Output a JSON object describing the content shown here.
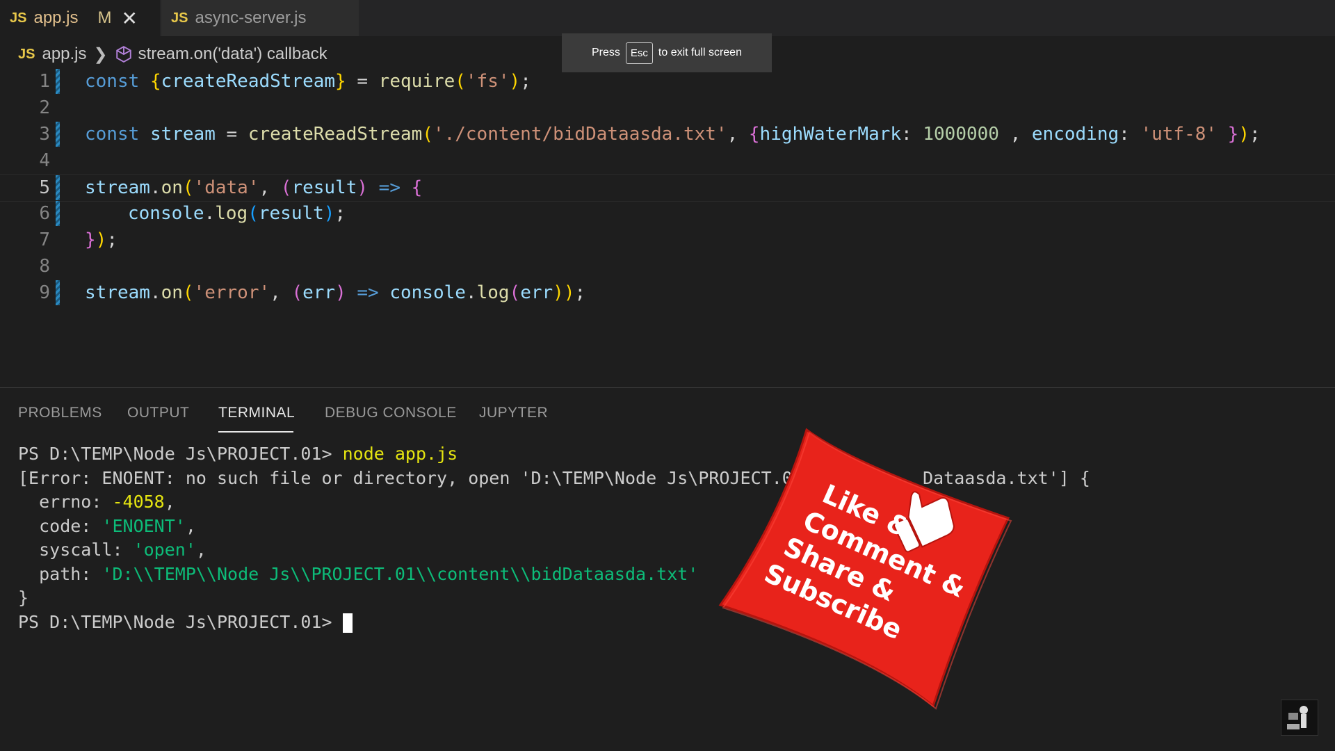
{
  "tabs": [
    {
      "badge": "JS",
      "label": "app.js",
      "modified": "M",
      "close": "✕"
    },
    {
      "badge": "JS",
      "label": "async-server.js"
    }
  ],
  "breadcrumb": {
    "badge": "JS",
    "file": "app.js",
    "sep": "❯",
    "symbol": "stream.on('data') callback"
  },
  "fullscreen_toast": {
    "before": "Press",
    "key": "Esc",
    "after": "to exit full screen"
  },
  "line_numbers": [
    "1",
    "2",
    "3",
    "4",
    "5",
    "6",
    "7",
    "8",
    "9"
  ],
  "code": {
    "l1": {
      "kw": "const",
      "open": "{",
      "ident": "createReadStream",
      "close": "}",
      "eq": " = ",
      "fn": "require",
      "p1": "(",
      "str": "'fs'",
      "p2": ")",
      "semi": ";"
    },
    "l3": {
      "kw": "const",
      "var": "stream",
      "eq": " = ",
      "fn": "createReadStream",
      "p1": "(",
      "str": "'./content/bidDataasda.txt'",
      "comma": ", ",
      "ob": "{",
      "k1": "highWaterMark",
      "c1": ": ",
      "n1": "1000000",
      "c2": " , ",
      "k2": "encoding",
      "c3": ": ",
      "s2": "'utf-8'",
      "cb": " }",
      "p2": ")",
      "semi": ";"
    },
    "l5": {
      "var": "stream",
      "dot": ".",
      "fn": "on",
      "p1": "(",
      "str": "'data'",
      "comma": ", ",
      "a1": "(",
      "arg": "result",
      "a2": ")",
      "arrow": " => ",
      "ob": "{"
    },
    "l6": {
      "var": "console",
      "dot": ".",
      "fn": "log",
      "p1": "(",
      "arg": "result",
      "p2": ")",
      "semi": ";"
    },
    "l7": {
      "cb": "}",
      "p": ")",
      "semi": ";"
    },
    "l9": {
      "var": "stream",
      "dot": ".",
      "fn": "on",
      "p1": "(",
      "str": "'error'",
      "comma": ", ",
      "a1": "(",
      "arg": "err",
      "a2": ")",
      "arrow": " => ",
      "obj": "console",
      "dot2": ".",
      "fn2": "log",
      "p2": "(",
      "arg2": "err",
      "p3": "))",
      "semi": ";"
    }
  },
  "panel_tabs": [
    "PROBLEMS",
    "OUTPUT",
    "TERMINAL",
    "DEBUG CONSOLE",
    "JUPYTER"
  ],
  "terminal": {
    "prompt": "PS D:\\TEMP\\Node Js\\PROJECT.01> ",
    "command": "node app.js",
    "error_line_a": "[Error: ENOENT: no such file or directory, open 'D:\\TEMP\\Node Js\\PROJECT.01\\con",
    "error_line_b": "Dataasda.txt'] {",
    "errno_key": "  errno: ",
    "errno_val": "-4058",
    "code_key": "  code: ",
    "code_val": "'ENOENT'",
    "syscall_key": "  syscall: ",
    "syscall_val": "'open'",
    "path_key": "  path: ",
    "path_val": "'D:\\\\TEMP\\\\Node Js\\\\PROJECT.01\\\\content\\\\bidDataasda.txt'",
    "close": "}",
    "prompt2": "PS D:\\TEMP\\Node Js\\PROJECT.01> ",
    "comma": ","
  },
  "overlay": {
    "lines": [
      "Like &",
      "Comment &",
      "Share &",
      "Subscribe"
    ],
    "thumbs_icon": "thumbs-up-icon"
  },
  "colors": {
    "editor_bg": "#1e1e1e",
    "keyword": "#569cd6",
    "string": "#ce9178",
    "number": "#b5cea8",
    "pillow": "#e8231b"
  }
}
